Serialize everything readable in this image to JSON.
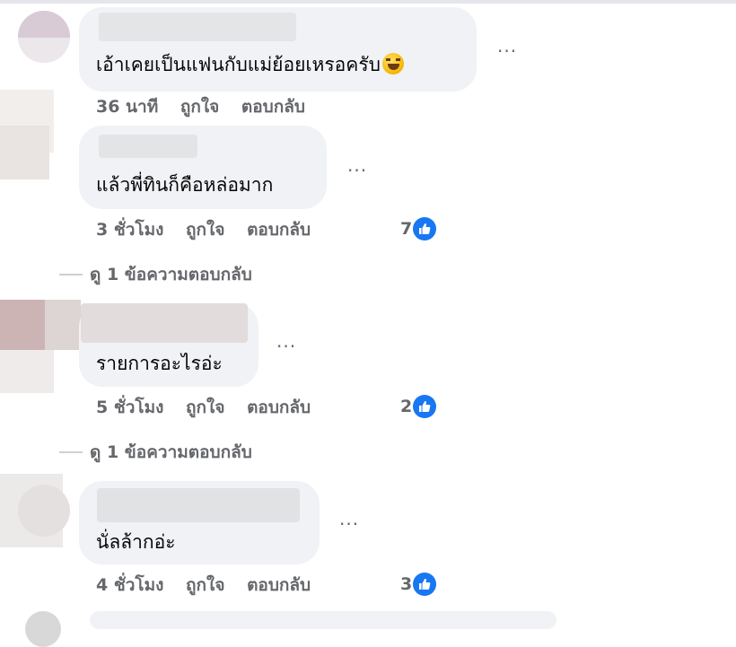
{
  "comments": [
    {
      "text": "เอ้าเคยเป็นแฟนกับแม่ย้อยเหรอครับ",
      "emoji": "rolling-on-floor-laughing-emoji",
      "more": "···",
      "time": "36 นาที",
      "like": "ถูกใจ",
      "reply": "ตอบกลับ"
    },
    {
      "text": "แล้วพี่ทินก็คือหล่อมาก",
      "more": "···",
      "time": "3 ชั่วโมง",
      "like": "ถูกใจ",
      "reply": "ตอบกลับ",
      "reactions": "7",
      "view_replies": "ดู 1 ข้อความตอบกลับ"
    },
    {
      "text": "รายการอะไรอ่ะ",
      "more": "···",
      "time": "5 ชั่วโมง",
      "like": "ถูกใจ",
      "reply": "ตอบกลับ",
      "reactions": "2",
      "view_replies": "ดู 1 ข้อความตอบกลับ"
    },
    {
      "text": "นั่ลล้ากอ่ะ",
      "more": "···",
      "time": "4 ชั่วโมง",
      "like": "ถูกใจ",
      "reply": "ตอบกลับ",
      "reactions": "3"
    }
  ],
  "colors": {
    "bubble": "#f0f2f5",
    "meta_text": "#65676b",
    "like_badge": "#1877f2",
    "text": "#050505"
  }
}
